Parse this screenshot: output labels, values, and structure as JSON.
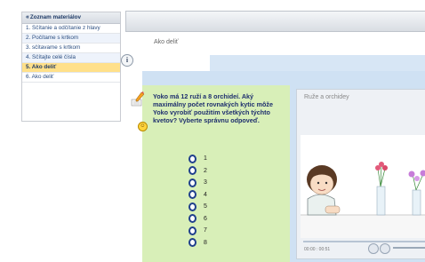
{
  "sidebar": {
    "header": "Zoznam materiálov",
    "items": [
      {
        "label": "1. Sčítanie a odčítanie z hlavy"
      },
      {
        "label": "2. Počítame s krtkom"
      },
      {
        "label": "3. sčítavame s krtkom"
      },
      {
        "label": "4. Sčítajte celé čísla"
      },
      {
        "label": "5. Ako deliť",
        "active": true
      },
      {
        "label": "6. Ako deliť"
      }
    ]
  },
  "lesson": {
    "title": "Ako deliť"
  },
  "question": {
    "text": "Yoko má 12 ruží a 8 orchideí. Aký maximálny počet rovnakých kytic môže Yoko vyrobiť použitím všetkých týchto kvetov? Vyberte správnu odpoveď.",
    "options": [
      "1",
      "2",
      "3",
      "4",
      "5",
      "6",
      "7",
      "8"
    ]
  },
  "video": {
    "title": "Ruže a orchidey",
    "time": "00:00 : 00:51"
  },
  "colors": {
    "accent_active": "#ffe08a",
    "question_bg": "#d8efb8",
    "blue_bg": "#cfe1f3"
  }
}
